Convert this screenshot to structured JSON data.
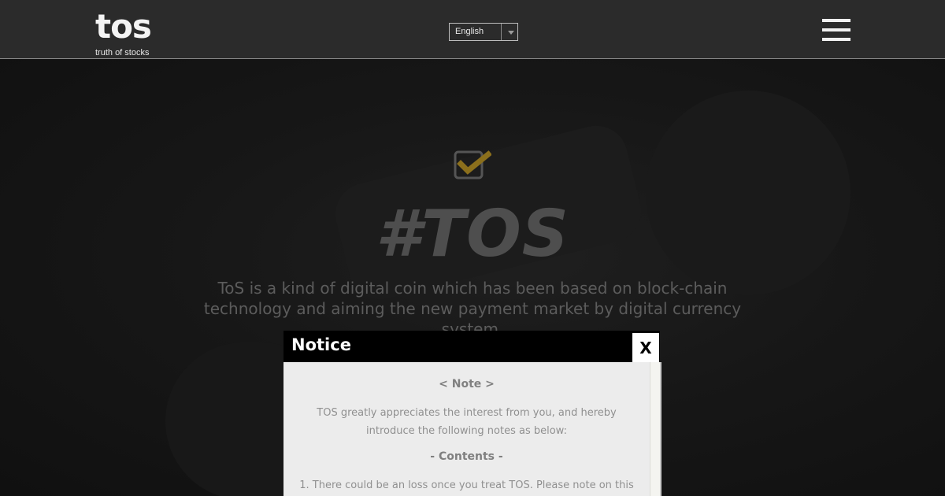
{
  "header": {
    "logo": {
      "word": "tos",
      "tagline": "truth of stocks"
    },
    "language_select": {
      "value": "English"
    },
    "menu_icon": "hamburger-menu-icon"
  },
  "hero": {
    "icon": "checkbox-checked-icon",
    "title": "#TOS",
    "description": "ToS is a kind of digital coin which has been based on block-chain technology and aiming the new payment market by digital currency system."
  },
  "modal": {
    "title": "Notice",
    "close_label": "X",
    "note_heading": "< Note >",
    "intro": "TOS greatly appreciates the interest from you, and hereby introduce the following notes as below:",
    "contents_heading": "- Contents -",
    "items": [
      "1. There could be an loss once you treat TOS. Please note on this"
    ]
  },
  "colors": {
    "header_bg": "#2b2b2b",
    "hero_bg": "#121212",
    "check_accent": "#8b6f1c",
    "modal_header_bg": "#000000",
    "modal_body_bg": "#ececec"
  }
}
